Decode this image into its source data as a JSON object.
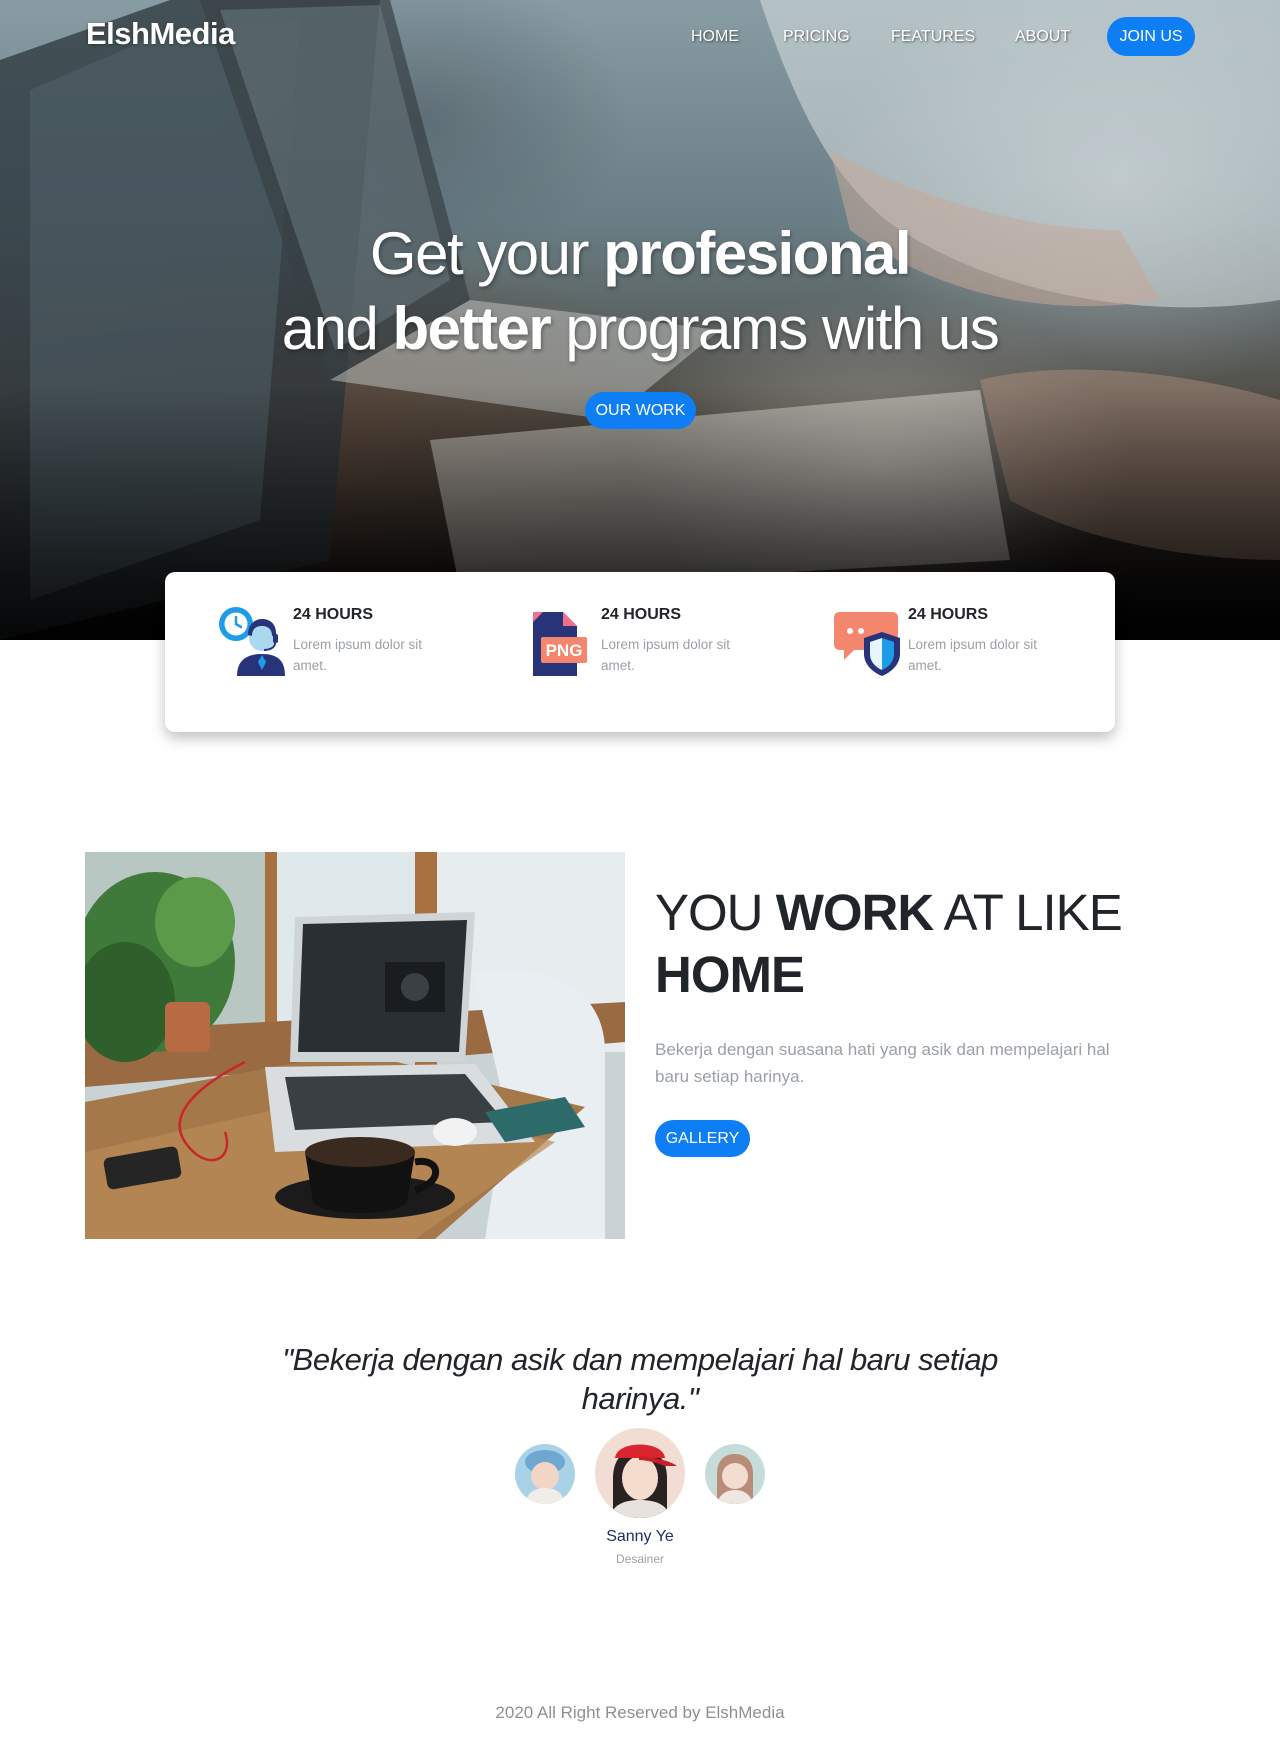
{
  "brand": {
    "name": "ElshMedia"
  },
  "nav": {
    "items": [
      {
        "label": "HOME"
      },
      {
        "label": "PRICING"
      },
      {
        "label": "FEATURES"
      },
      {
        "label": "ABOUT"
      }
    ],
    "join_label": "JOIN US"
  },
  "hero": {
    "title_part1": "Get your ",
    "title_bold1": "profesional",
    "title_part2": "and ",
    "title_bold2": "better",
    "title_part3": " programs with us",
    "button_label": "OUR WORK"
  },
  "features": [
    {
      "title": "24 HOURS",
      "text": "Lorem ipsum dolor sit amet.",
      "icon": "support-agent-clock-icon"
    },
    {
      "title": "24 HOURS",
      "text": "Lorem ipsum dolor sit amet.",
      "icon": "png-file-icon",
      "icon_label": "PNG"
    },
    {
      "title": "24 HOURS",
      "text": "Lorem ipsum dolor sit amet.",
      "icon": "chat-shield-icon"
    }
  ],
  "work": {
    "heading_part1": "YOU ",
    "heading_bold1": "WORK",
    "heading_part2": " AT LIKE",
    "heading_bold2": "HOME",
    "text": "Bekerja dengan suasana hati yang asik dan mempelajari hal baru setiap harinya.",
    "button_label": "GALLERY"
  },
  "testimonial": {
    "quote": "\"Bekerja dengan asik dan mempelajari hal baru setiap harinya.\"",
    "name": "Sanny Ye",
    "role": "Desainer"
  },
  "footer": {
    "text": "2020 All Right Reserved by ElshMedia"
  },
  "colors": {
    "accent": "#0d7ef3",
    "heading": "#212529",
    "muted": "#9aa0a6",
    "name": "#1d2b5c"
  }
}
